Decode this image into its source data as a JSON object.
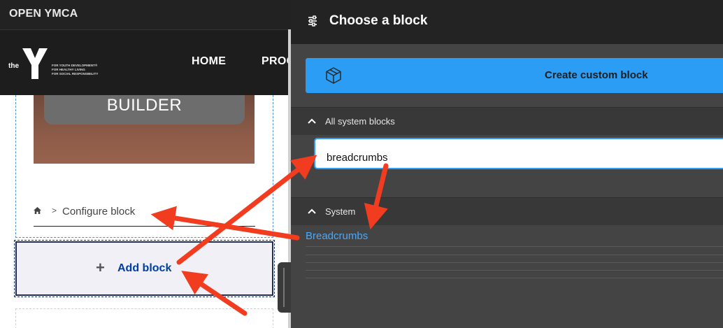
{
  "toolbar": {
    "site_name": "OPEN YMCA"
  },
  "site_header": {
    "logo_the": "the",
    "logo_tagline": [
      "FOR YOUTH DEVELOPMENT®",
      "FOR HEALTHY LIVING",
      "FOR SOCIAL RESPONSIBILITY"
    ],
    "nav": [
      "HOME",
      "PROG"
    ]
  },
  "hero": {
    "button_label": "BUILDER"
  },
  "breadcrumb": {
    "separator": ">",
    "current": "Configure block"
  },
  "layout_builder": {
    "add_block_plus": "+",
    "add_block_label": "Add block"
  },
  "panel": {
    "title": "Choose a block",
    "create_button": "Create custom block",
    "section_all": "All system blocks",
    "search": {
      "value": "breadcrumbs",
      "placeholder": ""
    },
    "section_system": "System",
    "results": [
      "Breadcrumbs"
    ]
  },
  "colors": {
    "accent": "#2b9df4",
    "link": "#4ca8f6",
    "add_block_text": "#003ea3",
    "annotation_arrow": "#f23c1f",
    "panel_bg": "#444444"
  },
  "icons": [
    "settings-sliders-icon",
    "cube-block-icon",
    "chevron-up-icon",
    "home-icon",
    "plus-icon"
  ]
}
